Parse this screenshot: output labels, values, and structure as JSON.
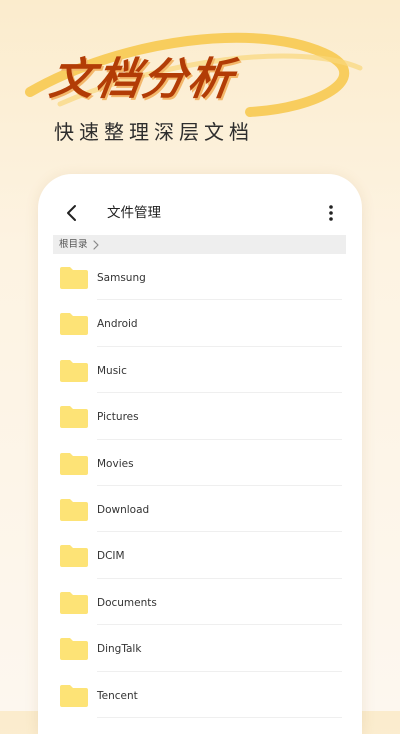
{
  "hero": {
    "title": "文档分析",
    "subtitle": "快速整理深层文档"
  },
  "colors": {
    "title": "#b23c06",
    "folder": "#fde376",
    "background": "#fbeccd",
    "swoosh": "#f7c749"
  },
  "appbar": {
    "title": "文件管理",
    "back_icon": "chevron-left-icon",
    "more_icon": "more-vertical-icon"
  },
  "breadcrumb": {
    "label": "根目录"
  },
  "files": [
    {
      "name": "Samsung"
    },
    {
      "name": "Android"
    },
    {
      "name": "Music"
    },
    {
      "name": "Pictures"
    },
    {
      "name": "Movies"
    },
    {
      "name": "Download"
    },
    {
      "name": "DCIM"
    },
    {
      "name": "Documents"
    },
    {
      "name": "DingTalk"
    },
    {
      "name": "Tencent"
    }
  ]
}
